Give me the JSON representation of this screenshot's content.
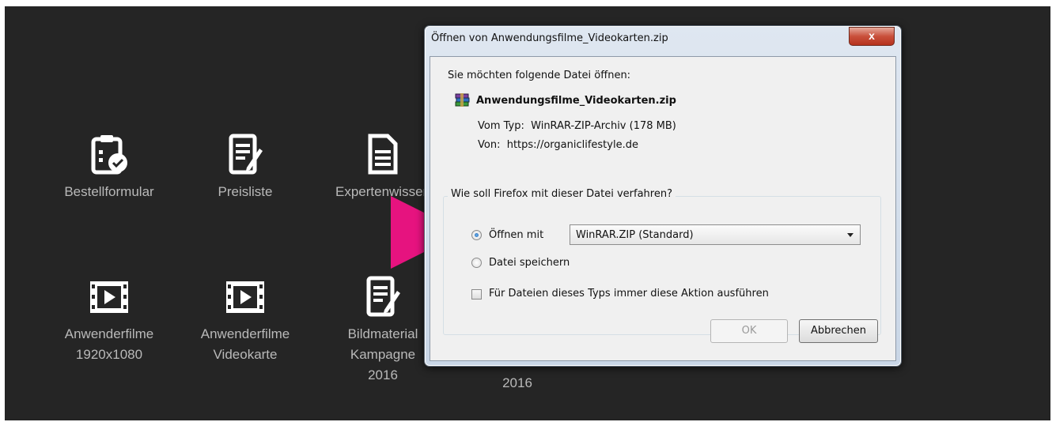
{
  "background": {
    "tiles": [
      {
        "icon": "clipboard-check-icon",
        "label": "Bestellformular"
      },
      {
        "icon": "document-edit-icon",
        "label": "Preisliste"
      },
      {
        "icon": "document-icon",
        "label": "Expertenwissen"
      },
      {
        "icon": "film-play-icon",
        "label": "Anwenderfilme\n1920x1080"
      },
      {
        "icon": "film-play-icon",
        "label": "Anwenderfilme\nVideokarte"
      },
      {
        "icon": "document-edit-icon",
        "label": "Bildmaterial\nKampagne\n2016"
      },
      {
        "label": "2016"
      }
    ],
    "arrow_color": "#e6137f"
  },
  "dialog": {
    "title": "Öffnen von Anwendungsfilme_Videokarten.zip",
    "close_label": "x",
    "intro": "Sie möchten folgende Datei öffnen:",
    "file_icon": "winrar-archive-icon",
    "file_name": "Anwendungsfilme_Videokarten.zip",
    "type_line": "Vom Typ:  WinRAR-ZIP-Archiv (178 MB)",
    "from_line": "Von:  https://organiclifestyle.de",
    "question": "Wie soll Firefox mit dieser Datei verfahren?",
    "open_with_label": "Öffnen mit",
    "open_with_selected": true,
    "open_with_app": "WinRAR.ZIP (Standard)",
    "save_label": "Datei speichern",
    "always_label": "Für Dateien dieses Typs immer diese Aktion ausführen",
    "always_checked": false,
    "ok_label": "OK",
    "cancel_label": "Abbrechen"
  }
}
